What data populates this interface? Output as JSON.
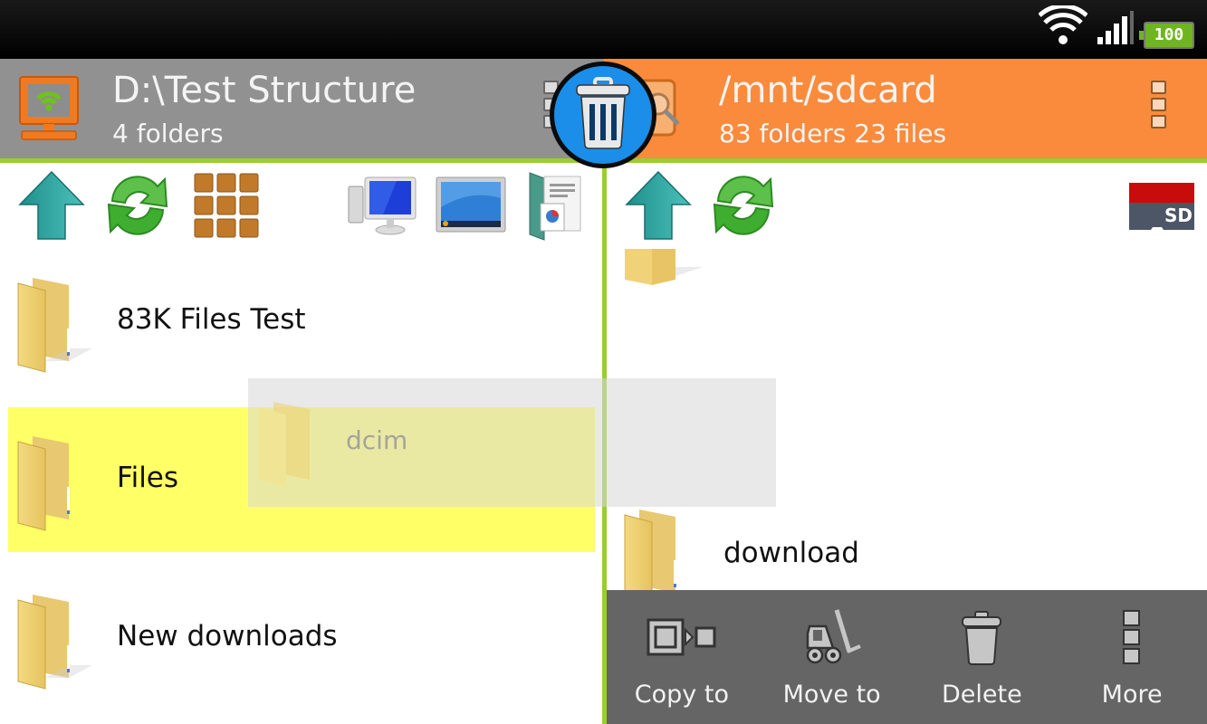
{
  "status_bar": {
    "wifi_icon": "wifi-icon",
    "signal_icon": "signal-bars-icon",
    "battery_level": "100"
  },
  "left_pane": {
    "title": "D:\\Test Structure",
    "subtitle": "4 folders",
    "source_icon": "network-computer-icon",
    "toolbar": [
      {
        "name": "up-button",
        "icon": "up-arrow-icon"
      },
      {
        "name": "refresh-button",
        "icon": "refresh-icon"
      },
      {
        "name": "grid-view-button",
        "icon": "grid-icon"
      },
      {
        "name": "computer-button",
        "icon": "computer-icon"
      },
      {
        "name": "desktop-button",
        "icon": "desktop-icon"
      },
      {
        "name": "documents-button",
        "icon": "documents-icon"
      }
    ],
    "items": [
      {
        "label": "83K Files Test",
        "selected": false
      },
      {
        "label": "Files",
        "selected": true
      },
      {
        "label": "New downloads",
        "selected": false
      }
    ]
  },
  "right_pane": {
    "title": "/mnt/sdcard",
    "subtitle": "83 folders 23 files",
    "toolbar": [
      {
        "name": "up-button",
        "icon": "up-arrow-icon"
      },
      {
        "name": "refresh-button",
        "icon": "refresh-icon"
      },
      {
        "name": "sd-card-button",
        "icon": "sd-card-icon",
        "label": "SD"
      }
    ],
    "items": [
      {
        "label": ""
      },
      {
        "label": "download"
      }
    ]
  },
  "drag_item": {
    "label": "dcim"
  },
  "floating_action": {
    "icon": "trash-icon"
  },
  "action_bar": [
    {
      "label": "Copy to",
      "icon": "copy-to-icon"
    },
    {
      "label": "Move to",
      "icon": "forklift-icon"
    },
    {
      "label": "Delete",
      "icon": "trash-icon"
    },
    {
      "label": "More",
      "icon": "more-vertical-icon"
    }
  ],
  "colors": {
    "left_header": "#919191",
    "right_header": "#fb8b3c",
    "divider": "#9acd32",
    "selection": "#ffff66",
    "action_bar": "#656565",
    "floating_button": "#1a8ee8"
  }
}
